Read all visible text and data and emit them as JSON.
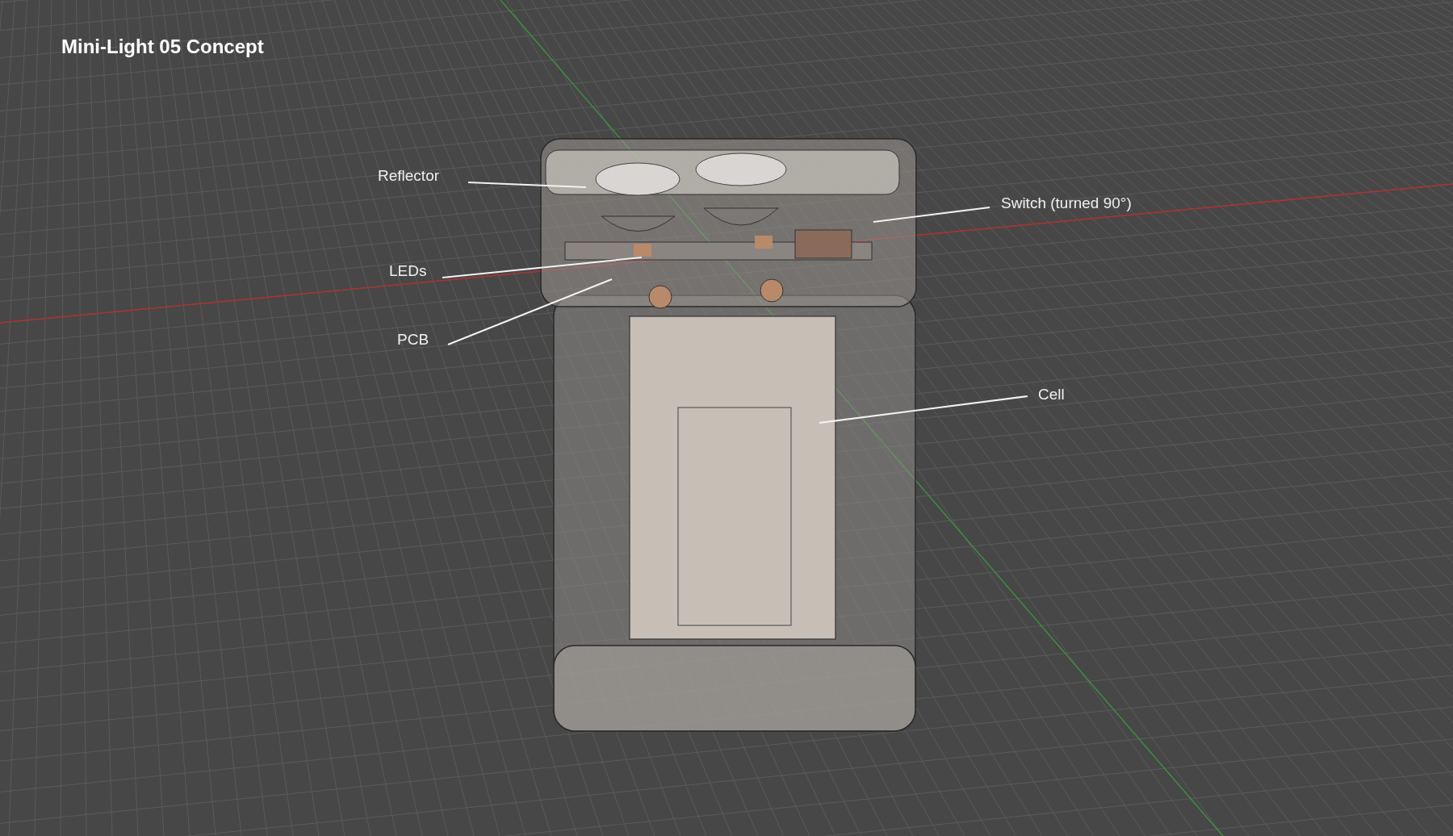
{
  "title": "Mini-Light 05 Concept",
  "callouts": [
    {
      "label": "Reflector"
    },
    {
      "label": "LEDs"
    },
    {
      "label": "PCB"
    },
    {
      "label": "Switch (turned 90°)"
    },
    {
      "label": "Cell"
    }
  ]
}
